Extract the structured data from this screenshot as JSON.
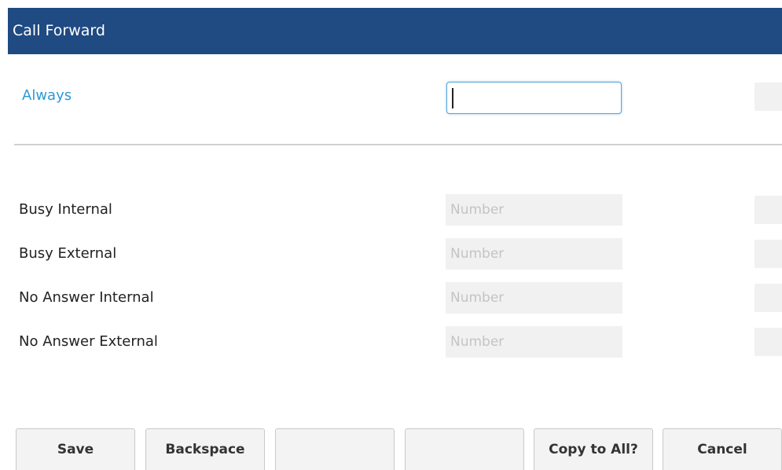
{
  "header": {
    "title": "Call Forward"
  },
  "always_row": {
    "label": "Always",
    "value": ""
  },
  "rows": [
    {
      "label": "Busy Internal",
      "placeholder": "Number"
    },
    {
      "label": "Busy External",
      "placeholder": "Number"
    },
    {
      "label": "No Answer Internal",
      "placeholder": "Number"
    },
    {
      "label": "No Answer External",
      "placeholder": "Number"
    }
  ],
  "softkeys": [
    "Save",
    "Backspace",
    "",
    "",
    "Copy to All?",
    "Cancel"
  ],
  "colors": {
    "header_bg": "#1f4a82",
    "active_label": "#2a9ad8",
    "focus_border": "#58a6dc"
  }
}
